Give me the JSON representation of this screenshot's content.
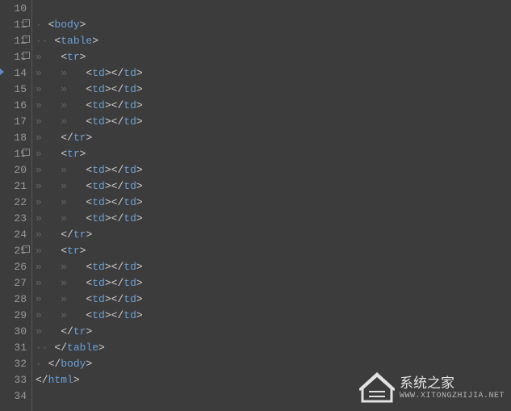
{
  "watermark": {
    "title": "系统之家",
    "url": "WWW.XITONGZHIJIA.NET"
  },
  "lines": [
    {
      "num": 10,
      "fold": "",
      "caret": false,
      "tokens": []
    },
    {
      "num": 11,
      "fold": "box",
      "caret": false,
      "tokens": [
        {
          "ws": "· "
        },
        {
          "open": "body"
        }
      ]
    },
    {
      "num": 12,
      "fold": "box",
      "caret": false,
      "tokens": [
        {
          "ws": "·· "
        },
        {
          "open": "table"
        }
      ]
    },
    {
      "num": 13,
      "fold": "box",
      "caret": false,
      "tokens": [
        {
          "ws": "»   "
        },
        {
          "open": "tr"
        }
      ]
    },
    {
      "num": 14,
      "fold": "",
      "caret": true,
      "tokens": [
        {
          "ws": "»   »   "
        },
        {
          "open": "td"
        },
        {
          "close": "td"
        }
      ]
    },
    {
      "num": 15,
      "fold": "",
      "caret": false,
      "tokens": [
        {
          "ws": "»   »   "
        },
        {
          "open": "td"
        },
        {
          "close": "td"
        }
      ]
    },
    {
      "num": 16,
      "fold": "",
      "caret": false,
      "tokens": [
        {
          "ws": "»   »   "
        },
        {
          "open": "td"
        },
        {
          "close": "td"
        }
      ]
    },
    {
      "num": 17,
      "fold": "",
      "caret": false,
      "tokens": [
        {
          "ws": "»   »   "
        },
        {
          "open": "td"
        },
        {
          "close": "td"
        }
      ]
    },
    {
      "num": 18,
      "fold": "",
      "caret": false,
      "tokens": [
        {
          "ws": "»   "
        },
        {
          "close": "tr"
        }
      ]
    },
    {
      "num": 19,
      "fold": "box",
      "caret": false,
      "tokens": [
        {
          "ws": "»   "
        },
        {
          "open": "tr"
        }
      ]
    },
    {
      "num": 20,
      "fold": "",
      "caret": false,
      "tokens": [
        {
          "ws": "»   »   "
        },
        {
          "open": "td"
        },
        {
          "close": "td"
        }
      ]
    },
    {
      "num": 21,
      "fold": "",
      "caret": false,
      "tokens": [
        {
          "ws": "»   »   "
        },
        {
          "open": "td"
        },
        {
          "close": "td"
        }
      ]
    },
    {
      "num": 22,
      "fold": "",
      "caret": false,
      "tokens": [
        {
          "ws": "»   »   "
        },
        {
          "open": "td"
        },
        {
          "close": "td"
        }
      ]
    },
    {
      "num": 23,
      "fold": "",
      "caret": false,
      "tokens": [
        {
          "ws": "»   »   "
        },
        {
          "open": "td"
        },
        {
          "close": "td"
        }
      ]
    },
    {
      "num": 24,
      "fold": "",
      "caret": false,
      "tokens": [
        {
          "ws": "»   "
        },
        {
          "close": "tr"
        }
      ]
    },
    {
      "num": 25,
      "fold": "box",
      "caret": false,
      "tokens": [
        {
          "ws": "»   "
        },
        {
          "open": "tr"
        }
      ]
    },
    {
      "num": 26,
      "fold": "",
      "caret": false,
      "tokens": [
        {
          "ws": "»   »   "
        },
        {
          "open": "td"
        },
        {
          "close": "td"
        }
      ]
    },
    {
      "num": 27,
      "fold": "",
      "caret": false,
      "tokens": [
        {
          "ws": "»   »   "
        },
        {
          "open": "td"
        },
        {
          "close": "td"
        }
      ]
    },
    {
      "num": 28,
      "fold": "",
      "caret": false,
      "tokens": [
        {
          "ws": "»   »   "
        },
        {
          "open": "td"
        },
        {
          "close": "td"
        }
      ]
    },
    {
      "num": 29,
      "fold": "",
      "caret": false,
      "tokens": [
        {
          "ws": "»   »   "
        },
        {
          "open": "td"
        },
        {
          "close": "td"
        }
      ]
    },
    {
      "num": 30,
      "fold": "",
      "caret": false,
      "tokens": [
        {
          "ws": "»   "
        },
        {
          "close": "tr"
        }
      ]
    },
    {
      "num": 31,
      "fold": "",
      "caret": false,
      "tokens": [
        {
          "ws": "·· "
        },
        {
          "close": "table"
        }
      ]
    },
    {
      "num": 32,
      "fold": "",
      "caret": false,
      "tokens": [
        {
          "ws": "· "
        },
        {
          "close": "body"
        }
      ]
    },
    {
      "num": 33,
      "fold": "",
      "caret": false,
      "tokens": [
        {
          "close": "html"
        }
      ]
    },
    {
      "num": 34,
      "fold": "",
      "caret": false,
      "tokens": []
    }
  ]
}
